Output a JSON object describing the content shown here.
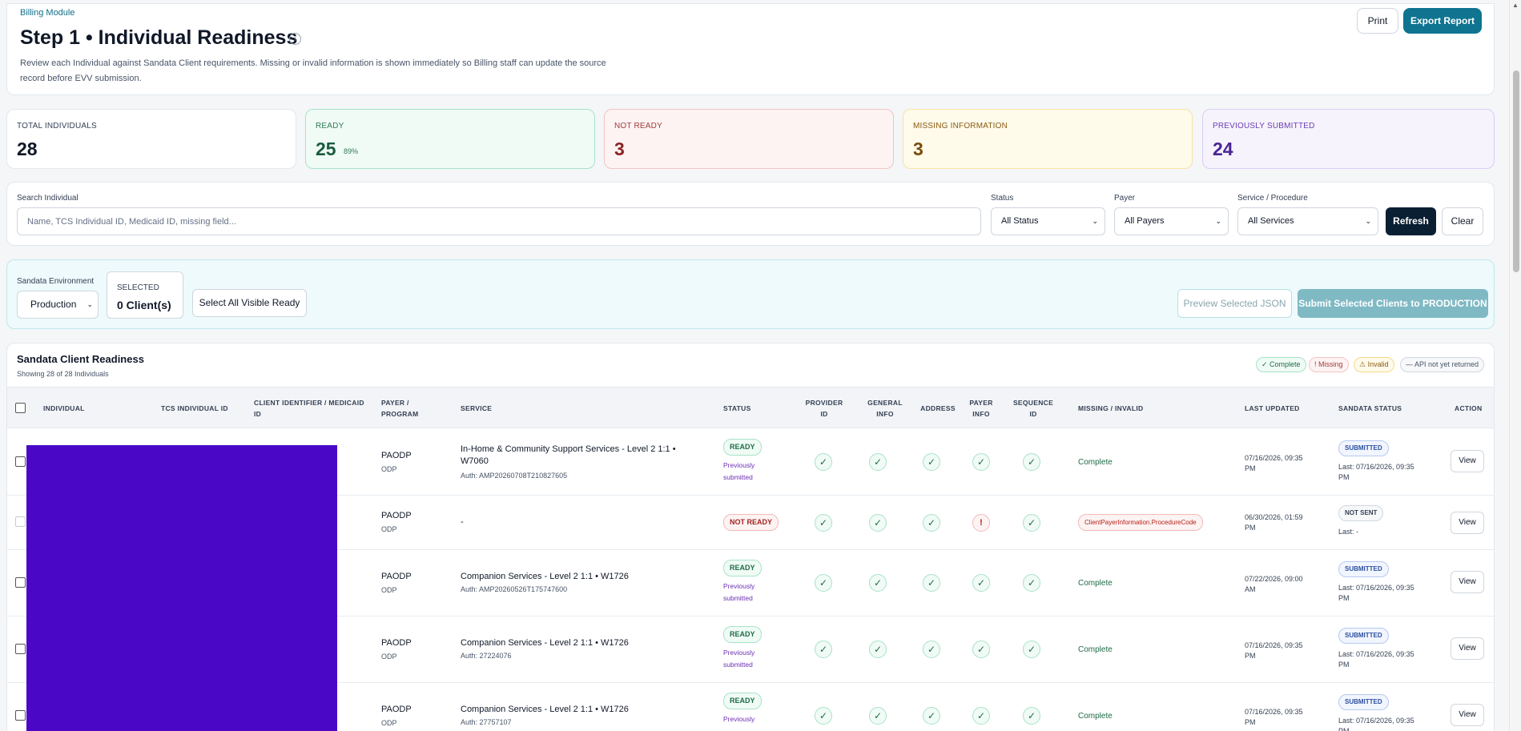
{
  "header": {
    "module": "Billing Module",
    "title": "Step 1 • Individual Readiness",
    "description": "Review each Individual against Sandata Client requirements. Missing or invalid information is shown immediately so Billing staff can update the source record before EVV submission.",
    "print_label": "Print",
    "export_label": "Export Report"
  },
  "stats": {
    "total_label": "TOTAL INDIVIDUALS",
    "total_value": "28",
    "ready_label": "READY",
    "ready_value": "25",
    "ready_pct": "89%",
    "notready_label": "NOT READY",
    "notready_value": "3",
    "missing_label": "MISSING INFORMATION",
    "missing_value": "3",
    "prev_label": "PREVIOUSLY SUBMITTED",
    "prev_value": "24"
  },
  "filters": {
    "search_label": "Search Individual",
    "search_placeholder": "Name, TCS Individual ID, Medicaid ID, missing field...",
    "status_label": "Status",
    "status_value": "All Status",
    "payer_label": "Payer",
    "payer_value": "All Payers",
    "service_label": "Service / Procedure",
    "service_value": "All Services",
    "refresh_label": "Refresh",
    "clear_label": "Clear"
  },
  "env": {
    "label": "Sandata Environment",
    "value": "Production",
    "selected_label": "SELECTED",
    "selected_value": "0 Client(s)",
    "select_all_label": "Select All Visible Ready",
    "preview_label": "Preview Selected JSON",
    "submit_label": "Submit Selected Clients to PRODUCTION"
  },
  "table": {
    "title": "Sandata Client Readiness",
    "subtitle": "Showing 28 of 28 Individuals",
    "legend": [
      "✓ Complete",
      "! Missing",
      "⚠ Invalid",
      "— API not yet returned"
    ],
    "columns": {
      "individual": "INDIVIDUAL",
      "tcs_id": "TCS INDIVIDUAL ID",
      "client_id": "CLIENT IDENTIFIER / MEDICAID ID",
      "payer": "PAYER / PROGRAM",
      "service": "SERVICE",
      "status": "STATUS",
      "provider": "PROVIDER ID",
      "general": "GENERAL INFO",
      "address": "ADDRESS",
      "payer_info": "PAYER INFO",
      "sequence": "SEQUENCE ID",
      "missing": "MISSING / INVALID",
      "updated": "LAST UPDATED",
      "sandata": "SANDATA STATUS",
      "action": "ACTION"
    },
    "rows": [
      {
        "payer": "PAODP",
        "program": "ODP",
        "service": "In-Home & Community Support Services - Level 2 1:1 • W7060",
        "auth": "Auth: AMP20260708T210827605",
        "status": "READY",
        "prev": "Previously submitted",
        "missing": "Complete",
        "updated": "07/16/2026, 09:35 PM",
        "sandata": "SUBMITTED",
        "last": "Last: 07/16/2026, 09:35 PM",
        "action": "View"
      },
      {
        "payer": "PAODP",
        "program": "ODP",
        "service": "-",
        "auth": "",
        "status": "NOT READY",
        "prev": "",
        "missing": "ClientPayerInformation.ProcedureCode",
        "updated": "06/30/2026, 01:59 PM",
        "sandata": "NOT SENT",
        "last": "Last: -",
        "action": "View"
      },
      {
        "payer": "PAODP",
        "program": "ODP",
        "service": "Companion Services - Level 2 1:1 • W1726",
        "auth": "Auth: AMP20260526T175747600",
        "status": "READY",
        "prev": "Previously submitted",
        "missing": "Complete",
        "updated": "07/22/2026, 09:00 AM",
        "sandata": "SUBMITTED",
        "last": "Last: 07/16/2026, 09:35 PM",
        "action": "View"
      },
      {
        "payer": "PAODP",
        "program": "ODP",
        "service": "Companion Services - Level 2 1:1 • W1726",
        "auth": "Auth: 27224076",
        "status": "READY",
        "prev": "Previously submitted",
        "missing": "Complete",
        "updated": "07/16/2026, 09:35 PM",
        "sandata": "SUBMITTED",
        "last": "Last: 07/16/2026, 09:35 PM",
        "action": "View"
      },
      {
        "payer": "PAODP",
        "program": "ODP",
        "service": "Companion Services - Level 2 1:1 • W1726",
        "auth": "Auth: 27757107",
        "status": "READY",
        "prev": "Previously",
        "missing": "Complete",
        "updated": "07/16/2026, 09:35 PM",
        "sandata": "SUBMITTED",
        "last": "Last: 07/16/2026, 09:35 PM",
        "action": "View"
      }
    ]
  },
  "icons": {
    "ok": "✓",
    "missing": "!",
    "info": "i",
    "chevron": "⌄",
    "scroll_up": "▲"
  }
}
